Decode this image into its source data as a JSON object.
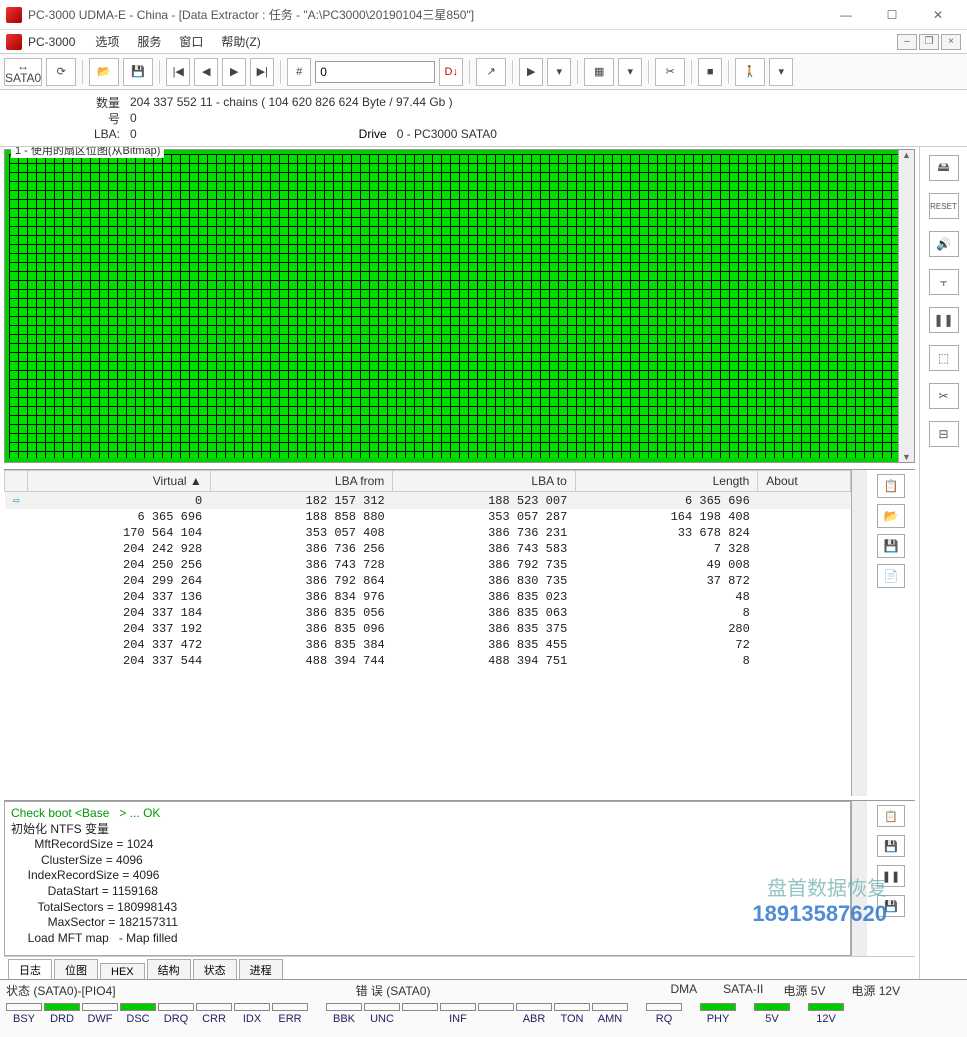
{
  "window": {
    "title": "PC-3000 UDMA-E - China - [Data Extractor : 任务 - \"A:\\PC3000\\20190104三星850\"]"
  },
  "menubar": {
    "brand": "PC-3000",
    "items": [
      "选项",
      "服务",
      "窗口",
      "帮助(Z)"
    ]
  },
  "toolbar": {
    "sata_label": "SATA0",
    "input_value": "0"
  },
  "info": {
    "qty_label": "数量",
    "qty_value": "204 337 552   11 - chains   ( 104 620 826 624 Byte /   97.44 Gb )",
    "num_label": "号",
    "num_value": "0",
    "lba_label": "LBA:",
    "lba_value": "0",
    "drive_label": "Drive",
    "drive_value": "0 - PC3000 SATA0"
  },
  "bitmap": {
    "title": "1 - 使用的扇区位图(从Bitmap)"
  },
  "table": {
    "headers": [
      "Virtual ▲",
      "LBA from",
      "LBA to",
      "Length",
      "About"
    ],
    "rows": [
      {
        "icon": "⇨",
        "v": "0",
        "f": "182 157 312",
        "t": "188 523 007",
        "l": "6 365 696",
        "a": ""
      },
      {
        "icon": "",
        "v": "6 365 696",
        "f": "188 858 880",
        "t": "353 057 287",
        "l": "164 198 408",
        "a": ""
      },
      {
        "icon": "",
        "v": "170 564 104",
        "f": "353 057 408",
        "t": "386 736 231",
        "l": "33 678 824",
        "a": ""
      },
      {
        "icon": "",
        "v": "204 242 928",
        "f": "386 736 256",
        "t": "386 743 583",
        "l": "7 328",
        "a": ""
      },
      {
        "icon": "",
        "v": "204 250 256",
        "f": "386 743 728",
        "t": "386 792 735",
        "l": "49 008",
        "a": ""
      },
      {
        "icon": "",
        "v": "204 299 264",
        "f": "386 792 864",
        "t": "386 830 735",
        "l": "37 872",
        "a": ""
      },
      {
        "icon": "",
        "v": "204 337 136",
        "f": "386 834 976",
        "t": "386 835 023",
        "l": "48",
        "a": ""
      },
      {
        "icon": "",
        "v": "204 337 184",
        "f": "386 835 056",
        "t": "386 835 063",
        "l": "8",
        "a": ""
      },
      {
        "icon": "",
        "v": "204 337 192",
        "f": "386 835 096",
        "t": "386 835 375",
        "l": "280",
        "a": ""
      },
      {
        "icon": "",
        "v": "204 337 472",
        "f": "386 835 384",
        "t": "386 835 455",
        "l": "72",
        "a": ""
      },
      {
        "icon": "",
        "v": "204 337 544",
        "f": "488 394 744",
        "t": "488 394 751",
        "l": "8",
        "a": ""
      }
    ]
  },
  "log": {
    "line_check": "Check boot <Base   > ... OK",
    "line_init": "初始化 NTFS 变量",
    "lines": [
      "       MftRecordSize = 1024",
      "         ClusterSize = 4096",
      "     IndexRecordSize = 4096",
      "           DataStart = 1159168",
      "        TotalSectors = 180998143",
      "           MaxSector = 182157311",
      "     Load MFT map   - Map filled"
    ],
    "tabs": [
      "日志",
      "位图",
      "HEX",
      "结构",
      "状态",
      "进程"
    ]
  },
  "status": {
    "group1_label": "状态 (SATA0)-[PIO4]",
    "group1": [
      {
        "name": "BSY",
        "on": false
      },
      {
        "name": "DRD",
        "on": true
      },
      {
        "name": "DWF",
        "on": false
      },
      {
        "name": "DSC",
        "on": true
      },
      {
        "name": "DRQ",
        "on": false
      },
      {
        "name": "CRR",
        "on": false
      },
      {
        "name": "IDX",
        "on": false
      },
      {
        "name": "ERR",
        "on": false
      }
    ],
    "group2_label": "错 误 (SATA0)",
    "group2": [
      {
        "name": "BBK",
        "on": false
      },
      {
        "name": "UNC",
        "on": false
      },
      {
        "name": "",
        "on": false
      },
      {
        "name": "INF",
        "on": false
      },
      {
        "name": "",
        "on": false
      },
      {
        "name": "ABR",
        "on": false
      },
      {
        "name": "TON",
        "on": false
      },
      {
        "name": "AMN",
        "on": false
      }
    ],
    "group3_label": "DMA",
    "group3": [
      {
        "name": "RQ",
        "on": false
      }
    ],
    "group4_label": "SATA-II",
    "group4": [
      {
        "name": "PHY",
        "on": true
      }
    ],
    "group5_label": "电源 5V",
    "group5": [
      {
        "name": "5V",
        "on": true
      }
    ],
    "group6_label": "电源 12V",
    "group6": [
      {
        "name": "12V",
        "on": true
      }
    ]
  },
  "watermark": {
    "l1": "盘首数据恢复",
    "l2": "18913587620"
  }
}
